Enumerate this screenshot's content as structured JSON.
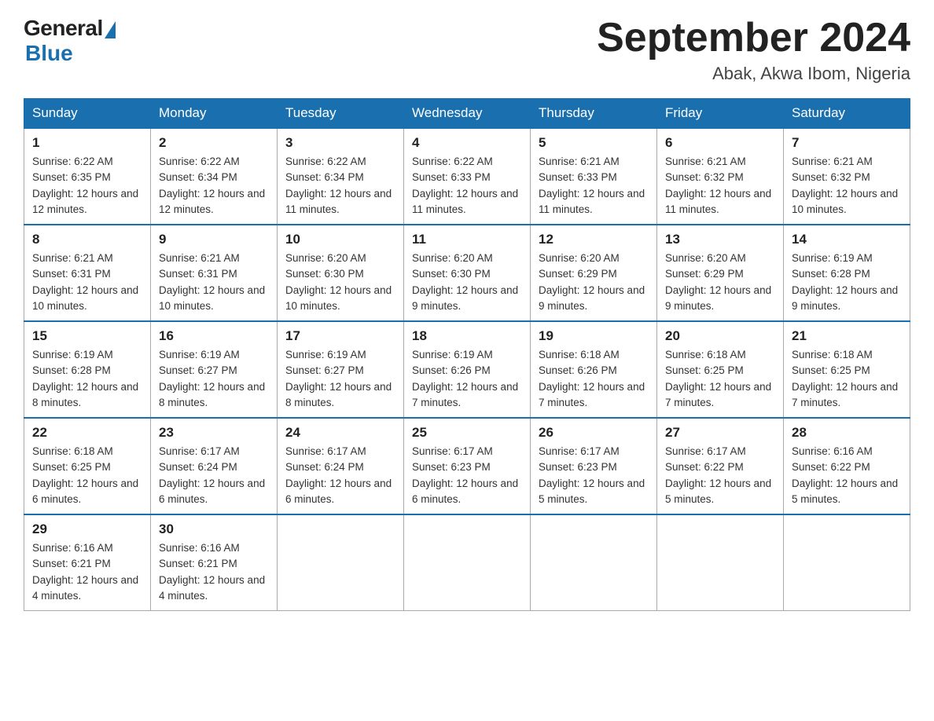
{
  "header": {
    "logo_general": "General",
    "logo_blue": "Blue",
    "month_title": "September 2024",
    "location": "Abak, Akwa Ibom, Nigeria"
  },
  "weekdays": [
    "Sunday",
    "Monday",
    "Tuesday",
    "Wednesday",
    "Thursday",
    "Friday",
    "Saturday"
  ],
  "weeks": [
    [
      {
        "day": "1",
        "sunrise": "6:22 AM",
        "sunset": "6:35 PM",
        "daylight": "12 hours and 12 minutes."
      },
      {
        "day": "2",
        "sunrise": "6:22 AM",
        "sunset": "6:34 PM",
        "daylight": "12 hours and 12 minutes."
      },
      {
        "day": "3",
        "sunrise": "6:22 AM",
        "sunset": "6:34 PM",
        "daylight": "12 hours and 11 minutes."
      },
      {
        "day": "4",
        "sunrise": "6:22 AM",
        "sunset": "6:33 PM",
        "daylight": "12 hours and 11 minutes."
      },
      {
        "day": "5",
        "sunrise": "6:21 AM",
        "sunset": "6:33 PM",
        "daylight": "12 hours and 11 minutes."
      },
      {
        "day": "6",
        "sunrise": "6:21 AM",
        "sunset": "6:32 PM",
        "daylight": "12 hours and 11 minutes."
      },
      {
        "day": "7",
        "sunrise": "6:21 AM",
        "sunset": "6:32 PM",
        "daylight": "12 hours and 10 minutes."
      }
    ],
    [
      {
        "day": "8",
        "sunrise": "6:21 AM",
        "sunset": "6:31 PM",
        "daylight": "12 hours and 10 minutes."
      },
      {
        "day": "9",
        "sunrise": "6:21 AM",
        "sunset": "6:31 PM",
        "daylight": "12 hours and 10 minutes."
      },
      {
        "day": "10",
        "sunrise": "6:20 AM",
        "sunset": "6:30 PM",
        "daylight": "12 hours and 10 minutes."
      },
      {
        "day": "11",
        "sunrise": "6:20 AM",
        "sunset": "6:30 PM",
        "daylight": "12 hours and 9 minutes."
      },
      {
        "day": "12",
        "sunrise": "6:20 AM",
        "sunset": "6:29 PM",
        "daylight": "12 hours and 9 minutes."
      },
      {
        "day": "13",
        "sunrise": "6:20 AM",
        "sunset": "6:29 PM",
        "daylight": "12 hours and 9 minutes."
      },
      {
        "day": "14",
        "sunrise": "6:19 AM",
        "sunset": "6:28 PM",
        "daylight": "12 hours and 9 minutes."
      }
    ],
    [
      {
        "day": "15",
        "sunrise": "6:19 AM",
        "sunset": "6:28 PM",
        "daylight": "12 hours and 8 minutes."
      },
      {
        "day": "16",
        "sunrise": "6:19 AM",
        "sunset": "6:27 PM",
        "daylight": "12 hours and 8 minutes."
      },
      {
        "day": "17",
        "sunrise": "6:19 AM",
        "sunset": "6:27 PM",
        "daylight": "12 hours and 8 minutes."
      },
      {
        "day": "18",
        "sunrise": "6:19 AM",
        "sunset": "6:26 PM",
        "daylight": "12 hours and 7 minutes."
      },
      {
        "day": "19",
        "sunrise": "6:18 AM",
        "sunset": "6:26 PM",
        "daylight": "12 hours and 7 minutes."
      },
      {
        "day": "20",
        "sunrise": "6:18 AM",
        "sunset": "6:25 PM",
        "daylight": "12 hours and 7 minutes."
      },
      {
        "day": "21",
        "sunrise": "6:18 AM",
        "sunset": "6:25 PM",
        "daylight": "12 hours and 7 minutes."
      }
    ],
    [
      {
        "day": "22",
        "sunrise": "6:18 AM",
        "sunset": "6:25 PM",
        "daylight": "12 hours and 6 minutes."
      },
      {
        "day": "23",
        "sunrise": "6:17 AM",
        "sunset": "6:24 PM",
        "daylight": "12 hours and 6 minutes."
      },
      {
        "day": "24",
        "sunrise": "6:17 AM",
        "sunset": "6:24 PM",
        "daylight": "12 hours and 6 minutes."
      },
      {
        "day": "25",
        "sunrise": "6:17 AM",
        "sunset": "6:23 PM",
        "daylight": "12 hours and 6 minutes."
      },
      {
        "day": "26",
        "sunrise": "6:17 AM",
        "sunset": "6:23 PM",
        "daylight": "12 hours and 5 minutes."
      },
      {
        "day": "27",
        "sunrise": "6:17 AM",
        "sunset": "6:22 PM",
        "daylight": "12 hours and 5 minutes."
      },
      {
        "day": "28",
        "sunrise": "6:16 AM",
        "sunset": "6:22 PM",
        "daylight": "12 hours and 5 minutes."
      }
    ],
    [
      {
        "day": "29",
        "sunrise": "6:16 AM",
        "sunset": "6:21 PM",
        "daylight": "12 hours and 4 minutes."
      },
      {
        "day": "30",
        "sunrise": "6:16 AM",
        "sunset": "6:21 PM",
        "daylight": "12 hours and 4 minutes."
      },
      null,
      null,
      null,
      null,
      null
    ]
  ]
}
